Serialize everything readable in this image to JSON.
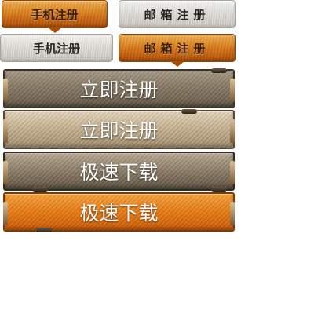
{
  "tabs_row1": {
    "phone": {
      "label": "手机注册",
      "state": "active",
      "style": "orange"
    },
    "email": {
      "label": "邮箱注册",
      "state": "inactive",
      "style": "silver"
    }
  },
  "tabs_row2": {
    "phone": {
      "label": "手机注册",
      "state": "inactive",
      "style": "silver"
    },
    "email": {
      "label": "邮箱注册",
      "state": "active",
      "style": "orange"
    }
  },
  "buttons": [
    {
      "label": "立即注册",
      "state": "normal"
    },
    {
      "label": "立即注册",
      "state": "hover"
    },
    {
      "label": "极速下载",
      "state": "normal"
    },
    {
      "label": "极速下载",
      "state": "hover"
    }
  ],
  "colors": {
    "orange_accent": "#e08a24",
    "silver": "#dedcd6",
    "bronze_dark": "#665a48",
    "bronze_light": "#c4b08f",
    "download_orange": "#ea7d14"
  }
}
